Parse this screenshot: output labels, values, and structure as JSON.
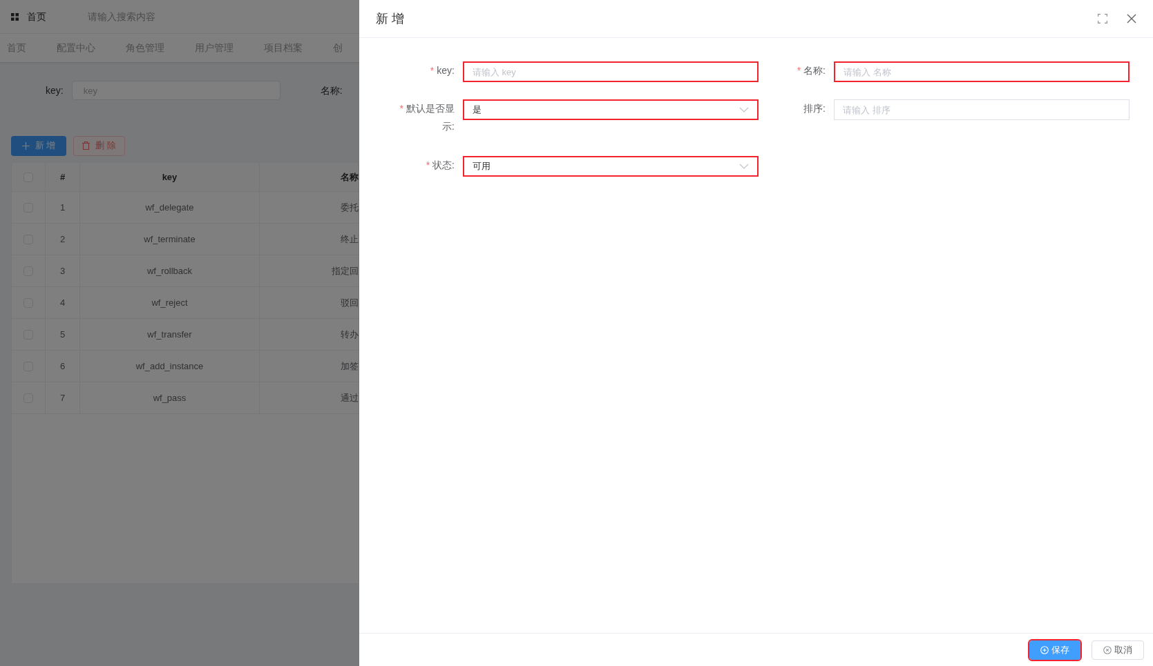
{
  "background": {
    "top_bar": {
      "home": "首页",
      "search_placeholder": "请输入搜索内容"
    },
    "nav_tabs": [
      {
        "label": "首页",
        "selected": false
      },
      {
        "label": "配置中心",
        "selected": false
      },
      {
        "label": "角色管理",
        "selected": false
      },
      {
        "label": "用户管理",
        "selected": false
      },
      {
        "label": "项目档案",
        "selected": false
      },
      {
        "label": "创",
        "selected": false
      }
    ],
    "filters": [
      {
        "label": "key:",
        "placeholder": "key"
      },
      {
        "label": "名称:"
      }
    ],
    "buttons": [
      {
        "label": "新 增",
        "kind": "primary"
      },
      {
        "label": "删 除",
        "kind": "danger"
      }
    ],
    "table": {
      "header_checked": false,
      "columns": [
        "#",
        "key",
        "名称"
      ],
      "rows": [
        {
          "checked": false,
          "cells": [
            "1",
            "wf_delegate",
            "委托"
          ]
        },
        {
          "checked": false,
          "cells": [
            "2",
            "wf_terminate",
            "终止"
          ]
        },
        {
          "checked": false,
          "cells": [
            "3",
            "wf_rollback",
            "指定回"
          ]
        },
        {
          "checked": false,
          "cells": [
            "4",
            "wf_reject",
            "驳回"
          ]
        },
        {
          "checked": false,
          "cells": [
            "5",
            "wf_transfer",
            "转办"
          ]
        },
        {
          "checked": false,
          "cells": [
            "6",
            "wf_add_instance",
            "加签"
          ]
        },
        {
          "checked": false,
          "cells": [
            "7",
            "wf_pass",
            "通过"
          ]
        }
      ]
    }
  },
  "drawer": {
    "title": "新 增",
    "fields": [
      {
        "label": "key:",
        "required_mark": "*",
        "kind": "input",
        "placeholder": "请输入 key",
        "highlighted": true
      },
      {
        "label": "名称:",
        "required_mark": "*",
        "kind": "input",
        "placeholder": "请输入 名称",
        "highlighted": true
      },
      {
        "label": "默认是否显示:",
        "required_mark": "*",
        "kind": "select",
        "value": "是",
        "highlighted": true
      },
      {
        "label": "排序:",
        "kind": "input",
        "placeholder": "请输入 排序",
        "highlighted": false
      },
      {
        "label": "状态:",
        "required_mark": "*",
        "kind": "select",
        "value": "可用",
        "highlighted": true
      }
    ],
    "footer": [
      {
        "label": "保存",
        "kind": "primary",
        "highlighted": true
      },
      {
        "label": "取消",
        "kind": "default",
        "highlighted": false
      }
    ]
  }
}
